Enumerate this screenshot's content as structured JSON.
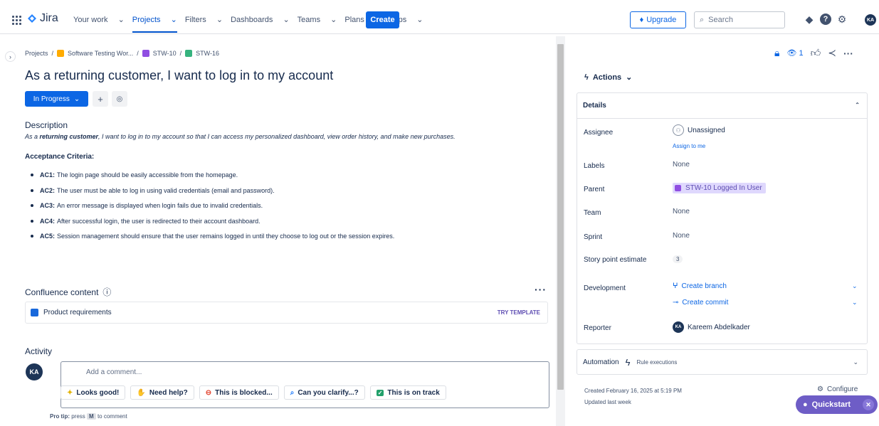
{
  "topbar": {
    "logo": "Jira",
    "nav": [
      "Your work",
      "Projects",
      "Filters",
      "Dashboards",
      "Teams",
      "Plans",
      "Apps"
    ],
    "create": "Create",
    "upgrade": "Upgrade",
    "search_placeholder": "Search",
    "user_initials": "KA"
  },
  "breadcrumb": {
    "projects": "Projects",
    "project": "Software Testing Wor...",
    "parent": "STW-10",
    "issue": "STW-16"
  },
  "issue": {
    "title": "As a returning customer, I want to log in to my account",
    "status": "In Progress",
    "description_heading": "Description",
    "description_prefix": "As a ",
    "description_bold": "returning customer",
    "description_suffix": ", I want to log in to my account so that I can access my personalized dashboard, view order history, and make new purchases.",
    "ac_heading": "Acceptance Criteria:",
    "criteria": [
      {
        "key": "AC1:",
        "text": "The login page should be easily accessible from the homepage."
      },
      {
        "key": "AC2:",
        "text": "The user must be able to log in using valid credentials (email and password)."
      },
      {
        "key": "AC3:",
        "text": "An error message is displayed when login fails due to invalid credentials."
      },
      {
        "key": "AC4:",
        "text": "After successful login, the user is redirected to their account dashboard."
      },
      {
        "key": "AC5:",
        "text": "Session management should ensure that the user remains logged in until they choose to log out or the session expires."
      }
    ]
  },
  "confluence": {
    "heading": "Confluence content",
    "item": "Product requirements",
    "try": "TRY TEMPLATE"
  },
  "activity": {
    "heading": "Activity",
    "placeholder": "Add a comment...",
    "chips": [
      "Looks good!",
      "Need help?",
      "This is blocked...",
      "Can you clarify...?",
      "This is on track"
    ],
    "tip_label": "Pro tip:",
    "tip_press": "press",
    "tip_key": "M",
    "tip_rest": "to comment"
  },
  "sidebar": {
    "watch_count": "1",
    "actions": "Actions",
    "details_heading": "Details",
    "assignee_label": "Assignee",
    "assignee_value": "Unassigned",
    "assign_to_me": "Assign to me",
    "labels_label": "Labels",
    "labels_value": "None",
    "parent_label": "Parent",
    "parent_value": "STW-10 Logged In User",
    "team_label": "Team",
    "team_value": "None",
    "sprint_label": "Sprint",
    "sprint_value": "None",
    "points_label": "Story point estimate",
    "points_value": "3",
    "dev_label": "Development",
    "create_branch": "Create branch",
    "create_commit": "Create commit",
    "reporter_label": "Reporter",
    "reporter_value": "Kareem Abdelkader",
    "reporter_initials": "KA",
    "automation": "Automation",
    "rule_exec": "Rule executions",
    "created": "Created February 16, 2025 at 5:19 PM",
    "updated": "Updated last week",
    "configure": "Configure",
    "quickstart": "Quickstart"
  },
  "colors": {
    "brand": "#0c66e4",
    "story": "#36b37e",
    "epic": "#904ee2",
    "quickstart": "#6e5dc6"
  }
}
